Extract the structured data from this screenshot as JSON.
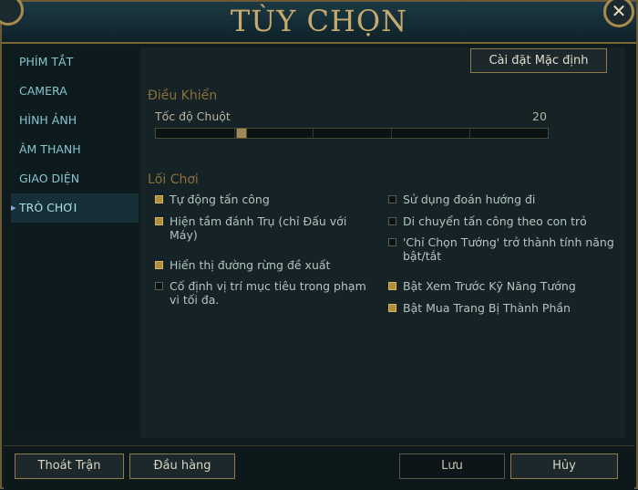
{
  "window": {
    "title": "TÙY CHỌN",
    "close_label": "✕"
  },
  "sidebar": {
    "items": [
      {
        "label": "PHÍM TẮT"
      },
      {
        "label": "CAMERA"
      },
      {
        "label": "HÌNH ẢNH"
      },
      {
        "label": "ÂM THANH"
      },
      {
        "label": "GIAO DIỆN"
      },
      {
        "label": "TRÒ CHƠI",
        "active": true
      }
    ]
  },
  "content": {
    "defaults_button": "Cài đặt Mặc định",
    "controls": {
      "title": "Điều Khiển",
      "mouse_speed_label": "Tốc độ Chuột",
      "mouse_speed_value": "20",
      "mouse_speed_fraction": 0.21
    },
    "gameplay": {
      "title": "Lối Chơi",
      "left_options": [
        {
          "label": "Tự động tấn công",
          "checked": true
        },
        {
          "label": "Hiện tầm đánh Trụ (chỉ Đấu với Máy)",
          "checked": true
        },
        {
          "label": "Hiển thị đường rừng đề xuất",
          "checked": true
        },
        {
          "label": "Cố định vị trí mục tiêu trong phạm vi tối đa.",
          "checked": false
        }
      ],
      "right_options": [
        {
          "label": "Sử dụng đoán hướng đi",
          "checked": false
        },
        {
          "label": "Di chuyển tấn công theo con trỏ",
          "checked": false
        },
        {
          "label": "'Chỉ Chọn Tướng' trở thành tính năng bật/tắt",
          "checked": false
        },
        {
          "label": "Bật Xem Trước Kỹ Năng Tướng",
          "checked": true
        },
        {
          "label": "Bật Mua Trang Bị Thành Phần",
          "checked": true
        }
      ]
    }
  },
  "footer": {
    "leave_match": "Thoát Trận",
    "surrender": "Đầu hàng",
    "save": "Lưu",
    "cancel": "Hủy"
  },
  "colors": {
    "accent_gold": "#c8aa6e",
    "teal_text": "#86c6cc",
    "checkbox_on": "#b08f3c"
  }
}
